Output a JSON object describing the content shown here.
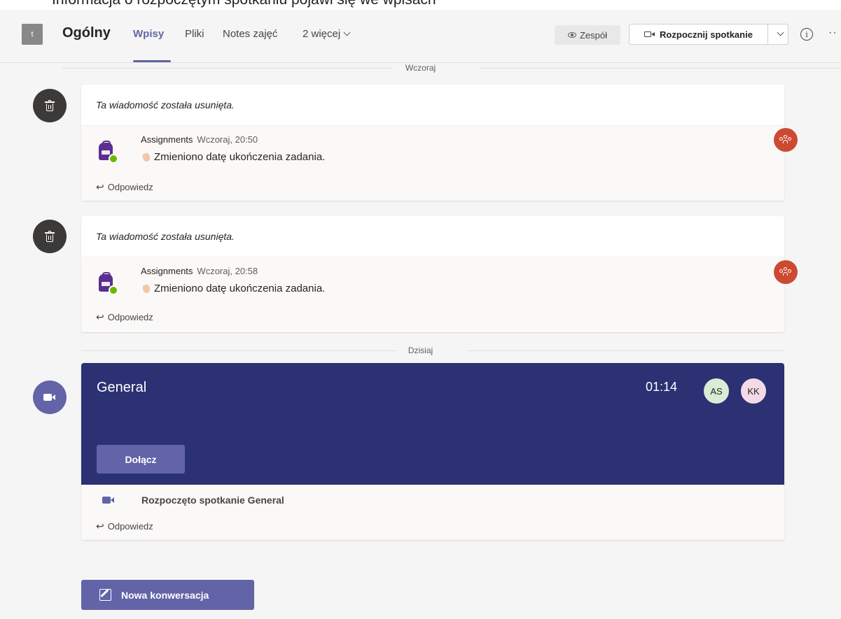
{
  "caption": "Informacja o rozpoczętym spotkaniu pojawi się we wpisach",
  "header": {
    "team_avatar": "t",
    "channel": "Ogólny",
    "tabs": [
      "Wpisy",
      "Pliki",
      "Notes zajęć",
      "2 więcej"
    ],
    "team_button": "Zespół",
    "meet_button": "Rozpocznij spotkanie"
  },
  "dividers": {
    "yesterday": "Wczoraj",
    "today": "Dzisiaj"
  },
  "posts": [
    {
      "deleted_text": "Ta wiadomość została usunięta.",
      "sender": "Assignments",
      "time": "Wczoraj, 20:50",
      "message": "Zmieniono datę ukończenia zadania.",
      "reply": "Odpowiedz"
    },
    {
      "deleted_text": "Ta wiadomość została usunięta.",
      "sender": "Assignments",
      "time": "Wczoraj, 20:58",
      "message": "Zmieniono datę ukończenia zadania.",
      "reply": "Odpowiedz"
    }
  ],
  "meeting": {
    "title": "General",
    "timer": "01:14",
    "participants": [
      "AS",
      "KK"
    ],
    "join_label": "Dołącz",
    "started_text": "Rozpoczęto spotkanie General",
    "reply": "Odpowiedz"
  },
  "new_conversation": "Nowa konwersacja",
  "colors": {
    "accent": "#6264a7",
    "meeting_banner": "#2b3173",
    "mention": "#cc4a31"
  }
}
